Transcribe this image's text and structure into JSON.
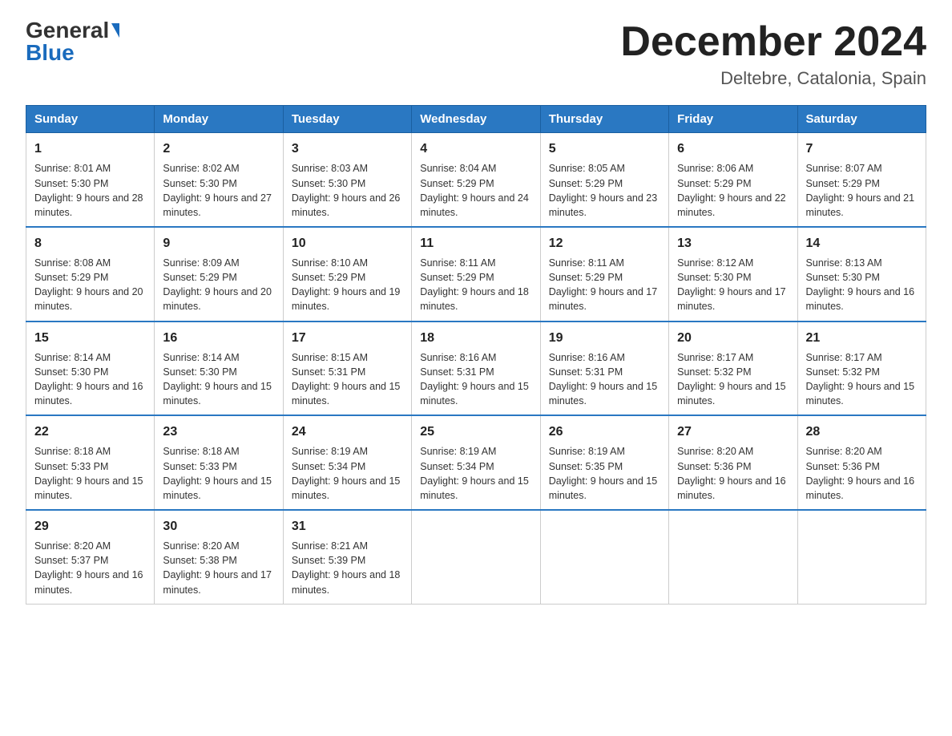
{
  "header": {
    "logo_general": "General",
    "logo_blue": "Blue",
    "title": "December 2024",
    "location": "Deltebre, Catalonia, Spain"
  },
  "days_of_week": [
    "Sunday",
    "Monday",
    "Tuesday",
    "Wednesday",
    "Thursday",
    "Friday",
    "Saturday"
  ],
  "weeks": [
    [
      {
        "day": "1",
        "sunrise": "8:01 AM",
        "sunset": "5:30 PM",
        "daylight": "9 hours and 28 minutes."
      },
      {
        "day": "2",
        "sunrise": "8:02 AM",
        "sunset": "5:30 PM",
        "daylight": "9 hours and 27 minutes."
      },
      {
        "day": "3",
        "sunrise": "8:03 AM",
        "sunset": "5:30 PM",
        "daylight": "9 hours and 26 minutes."
      },
      {
        "day": "4",
        "sunrise": "8:04 AM",
        "sunset": "5:29 PM",
        "daylight": "9 hours and 24 minutes."
      },
      {
        "day": "5",
        "sunrise": "8:05 AM",
        "sunset": "5:29 PM",
        "daylight": "9 hours and 23 minutes."
      },
      {
        "day": "6",
        "sunrise": "8:06 AM",
        "sunset": "5:29 PM",
        "daylight": "9 hours and 22 minutes."
      },
      {
        "day": "7",
        "sunrise": "8:07 AM",
        "sunset": "5:29 PM",
        "daylight": "9 hours and 21 minutes."
      }
    ],
    [
      {
        "day": "8",
        "sunrise": "8:08 AM",
        "sunset": "5:29 PM",
        "daylight": "9 hours and 20 minutes."
      },
      {
        "day": "9",
        "sunrise": "8:09 AM",
        "sunset": "5:29 PM",
        "daylight": "9 hours and 20 minutes."
      },
      {
        "day": "10",
        "sunrise": "8:10 AM",
        "sunset": "5:29 PM",
        "daylight": "9 hours and 19 minutes."
      },
      {
        "day": "11",
        "sunrise": "8:11 AM",
        "sunset": "5:29 PM",
        "daylight": "9 hours and 18 minutes."
      },
      {
        "day": "12",
        "sunrise": "8:11 AM",
        "sunset": "5:29 PM",
        "daylight": "9 hours and 17 minutes."
      },
      {
        "day": "13",
        "sunrise": "8:12 AM",
        "sunset": "5:30 PM",
        "daylight": "9 hours and 17 minutes."
      },
      {
        "day": "14",
        "sunrise": "8:13 AM",
        "sunset": "5:30 PM",
        "daylight": "9 hours and 16 minutes."
      }
    ],
    [
      {
        "day": "15",
        "sunrise": "8:14 AM",
        "sunset": "5:30 PM",
        "daylight": "9 hours and 16 minutes."
      },
      {
        "day": "16",
        "sunrise": "8:14 AM",
        "sunset": "5:30 PM",
        "daylight": "9 hours and 15 minutes."
      },
      {
        "day": "17",
        "sunrise": "8:15 AM",
        "sunset": "5:31 PM",
        "daylight": "9 hours and 15 minutes."
      },
      {
        "day": "18",
        "sunrise": "8:16 AM",
        "sunset": "5:31 PM",
        "daylight": "9 hours and 15 minutes."
      },
      {
        "day": "19",
        "sunrise": "8:16 AM",
        "sunset": "5:31 PM",
        "daylight": "9 hours and 15 minutes."
      },
      {
        "day": "20",
        "sunrise": "8:17 AM",
        "sunset": "5:32 PM",
        "daylight": "9 hours and 15 minutes."
      },
      {
        "day": "21",
        "sunrise": "8:17 AM",
        "sunset": "5:32 PM",
        "daylight": "9 hours and 15 minutes."
      }
    ],
    [
      {
        "day": "22",
        "sunrise": "8:18 AM",
        "sunset": "5:33 PM",
        "daylight": "9 hours and 15 minutes."
      },
      {
        "day": "23",
        "sunrise": "8:18 AM",
        "sunset": "5:33 PM",
        "daylight": "9 hours and 15 minutes."
      },
      {
        "day": "24",
        "sunrise": "8:19 AM",
        "sunset": "5:34 PM",
        "daylight": "9 hours and 15 minutes."
      },
      {
        "day": "25",
        "sunrise": "8:19 AM",
        "sunset": "5:34 PM",
        "daylight": "9 hours and 15 minutes."
      },
      {
        "day": "26",
        "sunrise": "8:19 AM",
        "sunset": "5:35 PM",
        "daylight": "9 hours and 15 minutes."
      },
      {
        "day": "27",
        "sunrise": "8:20 AM",
        "sunset": "5:36 PM",
        "daylight": "9 hours and 16 minutes."
      },
      {
        "day": "28",
        "sunrise": "8:20 AM",
        "sunset": "5:36 PM",
        "daylight": "9 hours and 16 minutes."
      }
    ],
    [
      {
        "day": "29",
        "sunrise": "8:20 AM",
        "sunset": "5:37 PM",
        "daylight": "9 hours and 16 minutes."
      },
      {
        "day": "30",
        "sunrise": "8:20 AM",
        "sunset": "5:38 PM",
        "daylight": "9 hours and 17 minutes."
      },
      {
        "day": "31",
        "sunrise": "8:21 AM",
        "sunset": "5:39 PM",
        "daylight": "9 hours and 18 minutes."
      },
      null,
      null,
      null,
      null
    ]
  ]
}
